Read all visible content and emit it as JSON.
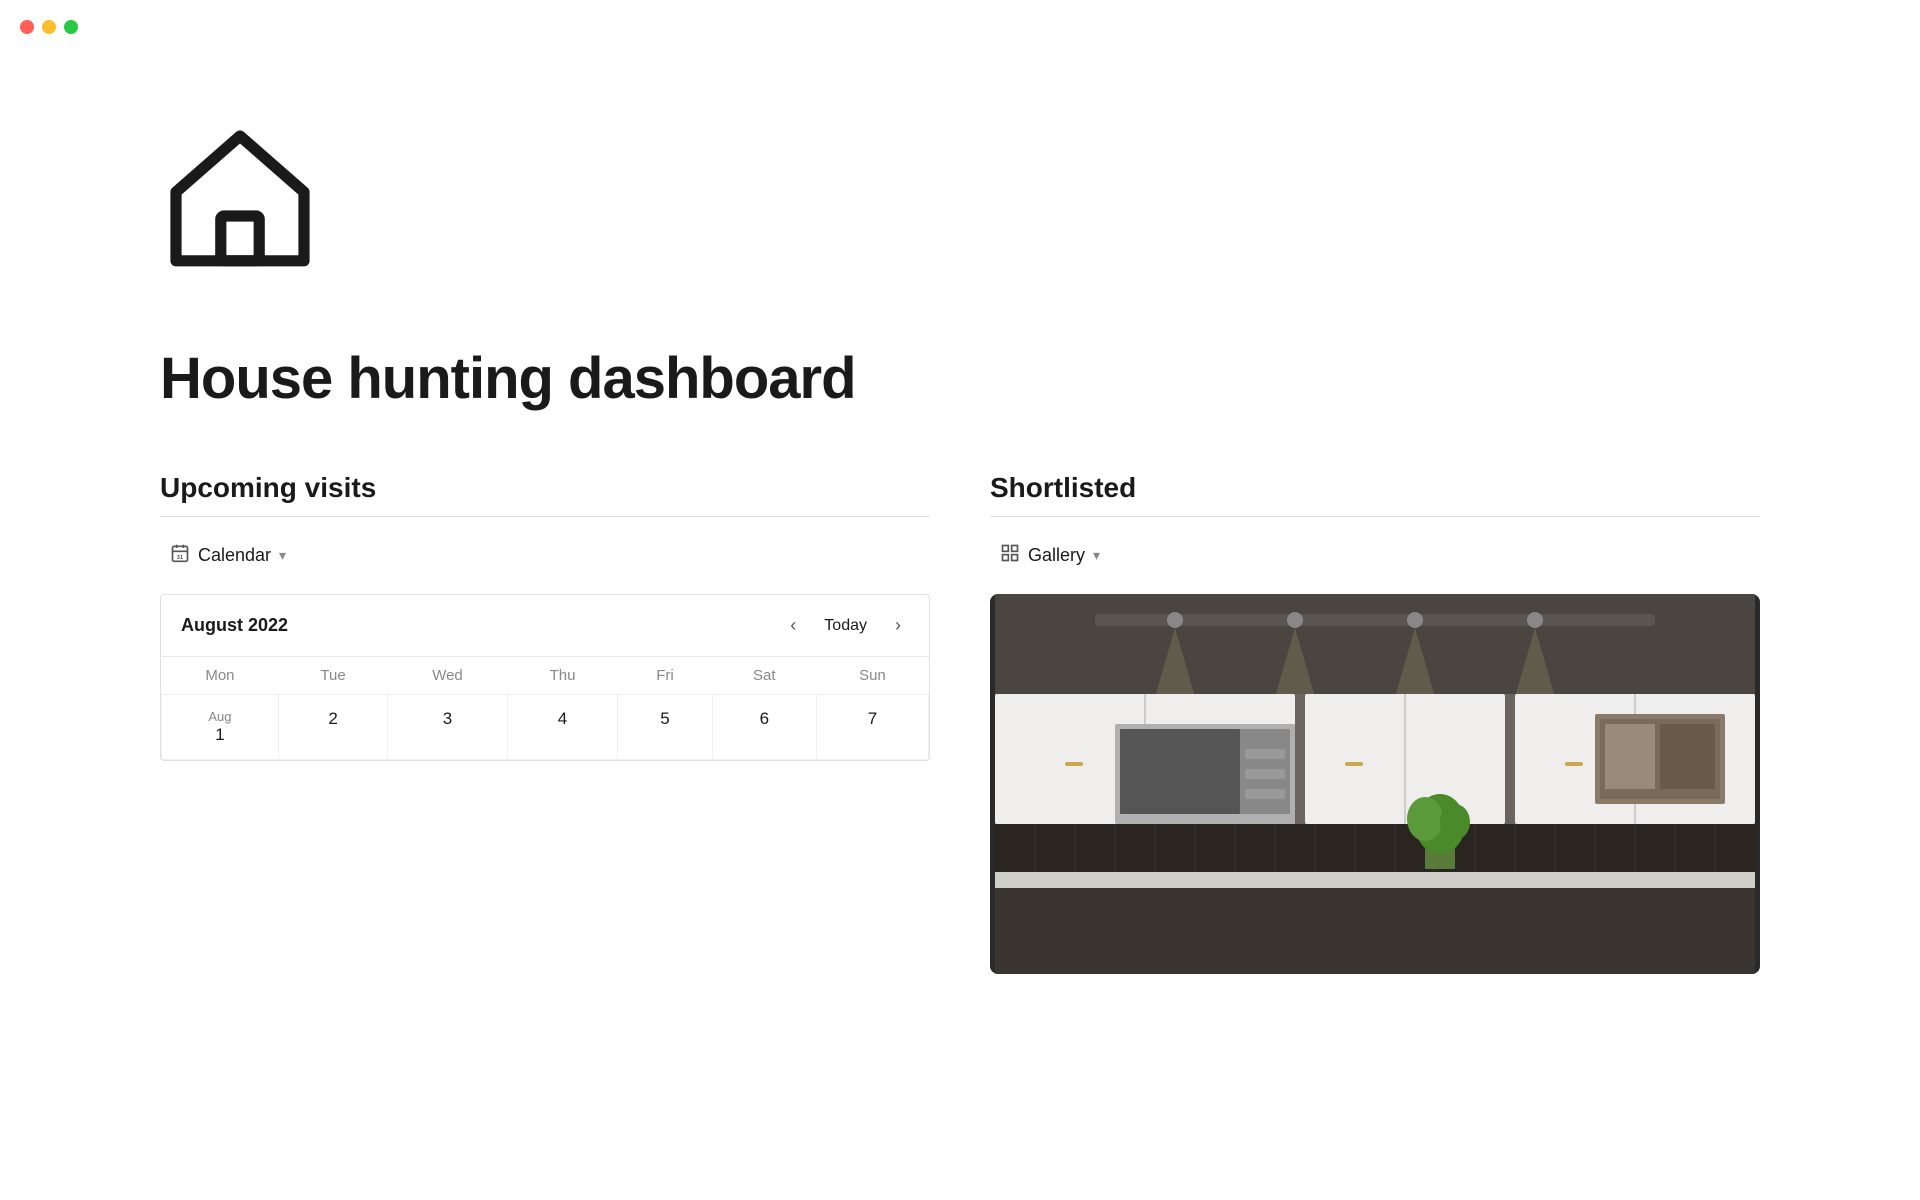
{
  "app": {
    "traffic_lights": {
      "red": "#ff5f57",
      "yellow": "#ffbd2e",
      "green": "#28ca41"
    }
  },
  "page": {
    "title": "House hunting dashboard",
    "icon": "home-icon"
  },
  "sections": {
    "upcoming_visits": {
      "title": "Upcoming visits",
      "view": {
        "label": "Calendar",
        "icon": "calendar-icon",
        "chevron": "chevron-down-icon"
      },
      "calendar": {
        "month_year": "August 2022",
        "today_label": "Today",
        "days": [
          "Mon",
          "Tue",
          "Wed",
          "Thu",
          "Fri",
          "Sat",
          "Sun"
        ],
        "weeks": [
          [
            "Aug\n1",
            "2",
            "3",
            "4",
            "5",
            "6",
            "7"
          ]
        ]
      }
    },
    "shortlisted": {
      "title": "Shortlisted",
      "view": {
        "label": "Gallery",
        "icon": "gallery-icon",
        "chevron": "chevron-down-icon"
      }
    }
  }
}
